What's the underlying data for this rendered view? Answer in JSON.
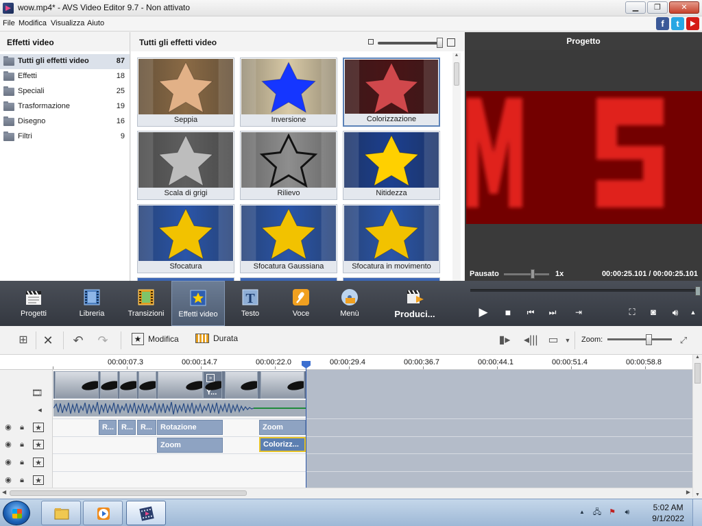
{
  "window": {
    "title": "wow.mp4* - AVS Video Editor 9.7 - Non attivato",
    "buttons": {
      "minimize": "▁",
      "maximize": "❐",
      "close": "✕"
    }
  },
  "menu": [
    "File",
    "Modifica",
    "Visualizza",
    "Aiuto"
  ],
  "social": [
    "f",
    "t"
  ],
  "categories": {
    "header": "Effetti video",
    "items": [
      {
        "label": "Tutti gli effetti video",
        "count": "87"
      },
      {
        "label": "Effetti",
        "count": "18"
      },
      {
        "label": "Speciali",
        "count": "25"
      },
      {
        "label": "Trasformazione",
        "count": "19"
      },
      {
        "label": "Disegno",
        "count": "16"
      },
      {
        "label": "Filtri",
        "count": "9"
      }
    ]
  },
  "effects": {
    "header": "Tutti gli effetti video",
    "tiles": [
      {
        "label": "Seppia",
        "bg": "#8a6a45",
        "star": "#e2b187",
        "style": "plain"
      },
      {
        "label": "Inversione",
        "bg": "#d8c9a6",
        "star": "#1536ff",
        "style": "plain"
      },
      {
        "label": "Colorizzazione",
        "bg": "#4a1416",
        "star": "#d0484c",
        "style": "plain"
      },
      {
        "label": "Scala di grigi",
        "bg": "#5f5f5f",
        "star": "#bdbdbd",
        "style": "plain"
      },
      {
        "label": "Rilievo",
        "bg": "#8e8e8e",
        "star": "#9a9a9a",
        "style": "outline"
      },
      {
        "label": "Nitidezza",
        "bg": "#1b3f8f",
        "star": "#ffd000",
        "style": "plain"
      },
      {
        "label": "Sfocatura",
        "bg": "#2a55a8",
        "star": "#f2c200",
        "style": "plain"
      },
      {
        "label": "Sfocatura Gaussiana",
        "bg": "#2a55a8",
        "star": "#f2c200",
        "style": "plain"
      },
      {
        "label": "Sfocatura in movimento",
        "bg": "#2a55a8",
        "star": "#f2c200",
        "style": "plain"
      }
    ]
  },
  "preview": {
    "header": "Progetto",
    "state": "Pausato",
    "speed": "1x",
    "time": "00:00:25.101  /  00:00:25.101"
  },
  "modules": [
    {
      "label": "Progetti",
      "icon": "clapper-icon"
    },
    {
      "label": "Libreria",
      "icon": "film-icon"
    },
    {
      "label": "Transizioni",
      "icon": "transition-icon"
    },
    {
      "label": "Effetti video",
      "icon": "star-icon"
    },
    {
      "label": "Testo",
      "icon": "text-icon"
    },
    {
      "label": "Voce",
      "icon": "microphone-icon"
    },
    {
      "label": "Menù",
      "icon": "disc-icon"
    },
    {
      "label": "Produci...",
      "icon": "produce-icon"
    }
  ],
  "timeline_toolbar": {
    "modify": "Modifica",
    "duration": "Durata",
    "zoom": "Zoom:"
  },
  "ruler": [
    "00:00:07.3",
    "00:00:14.7",
    "00:00:22.0",
    "00:00:29.4",
    "00:00:36.7",
    "00:00:44.1",
    "00:00:51.4",
    "00:00:58.8"
  ],
  "timeline": {
    "clip_label": "Y...",
    "track1": [
      "R...",
      "R...",
      "R...",
      "Rotazione",
      "Zoom"
    ],
    "track2": [
      "Zoom",
      "Colorizz..."
    ]
  },
  "taskbar": {
    "time": "5:02 AM",
    "date": "9/1/2022"
  },
  "colors": {
    "accent": "#5b82b8",
    "toolbar_dark": "#3b3f47",
    "video_red": "#e0221f"
  }
}
